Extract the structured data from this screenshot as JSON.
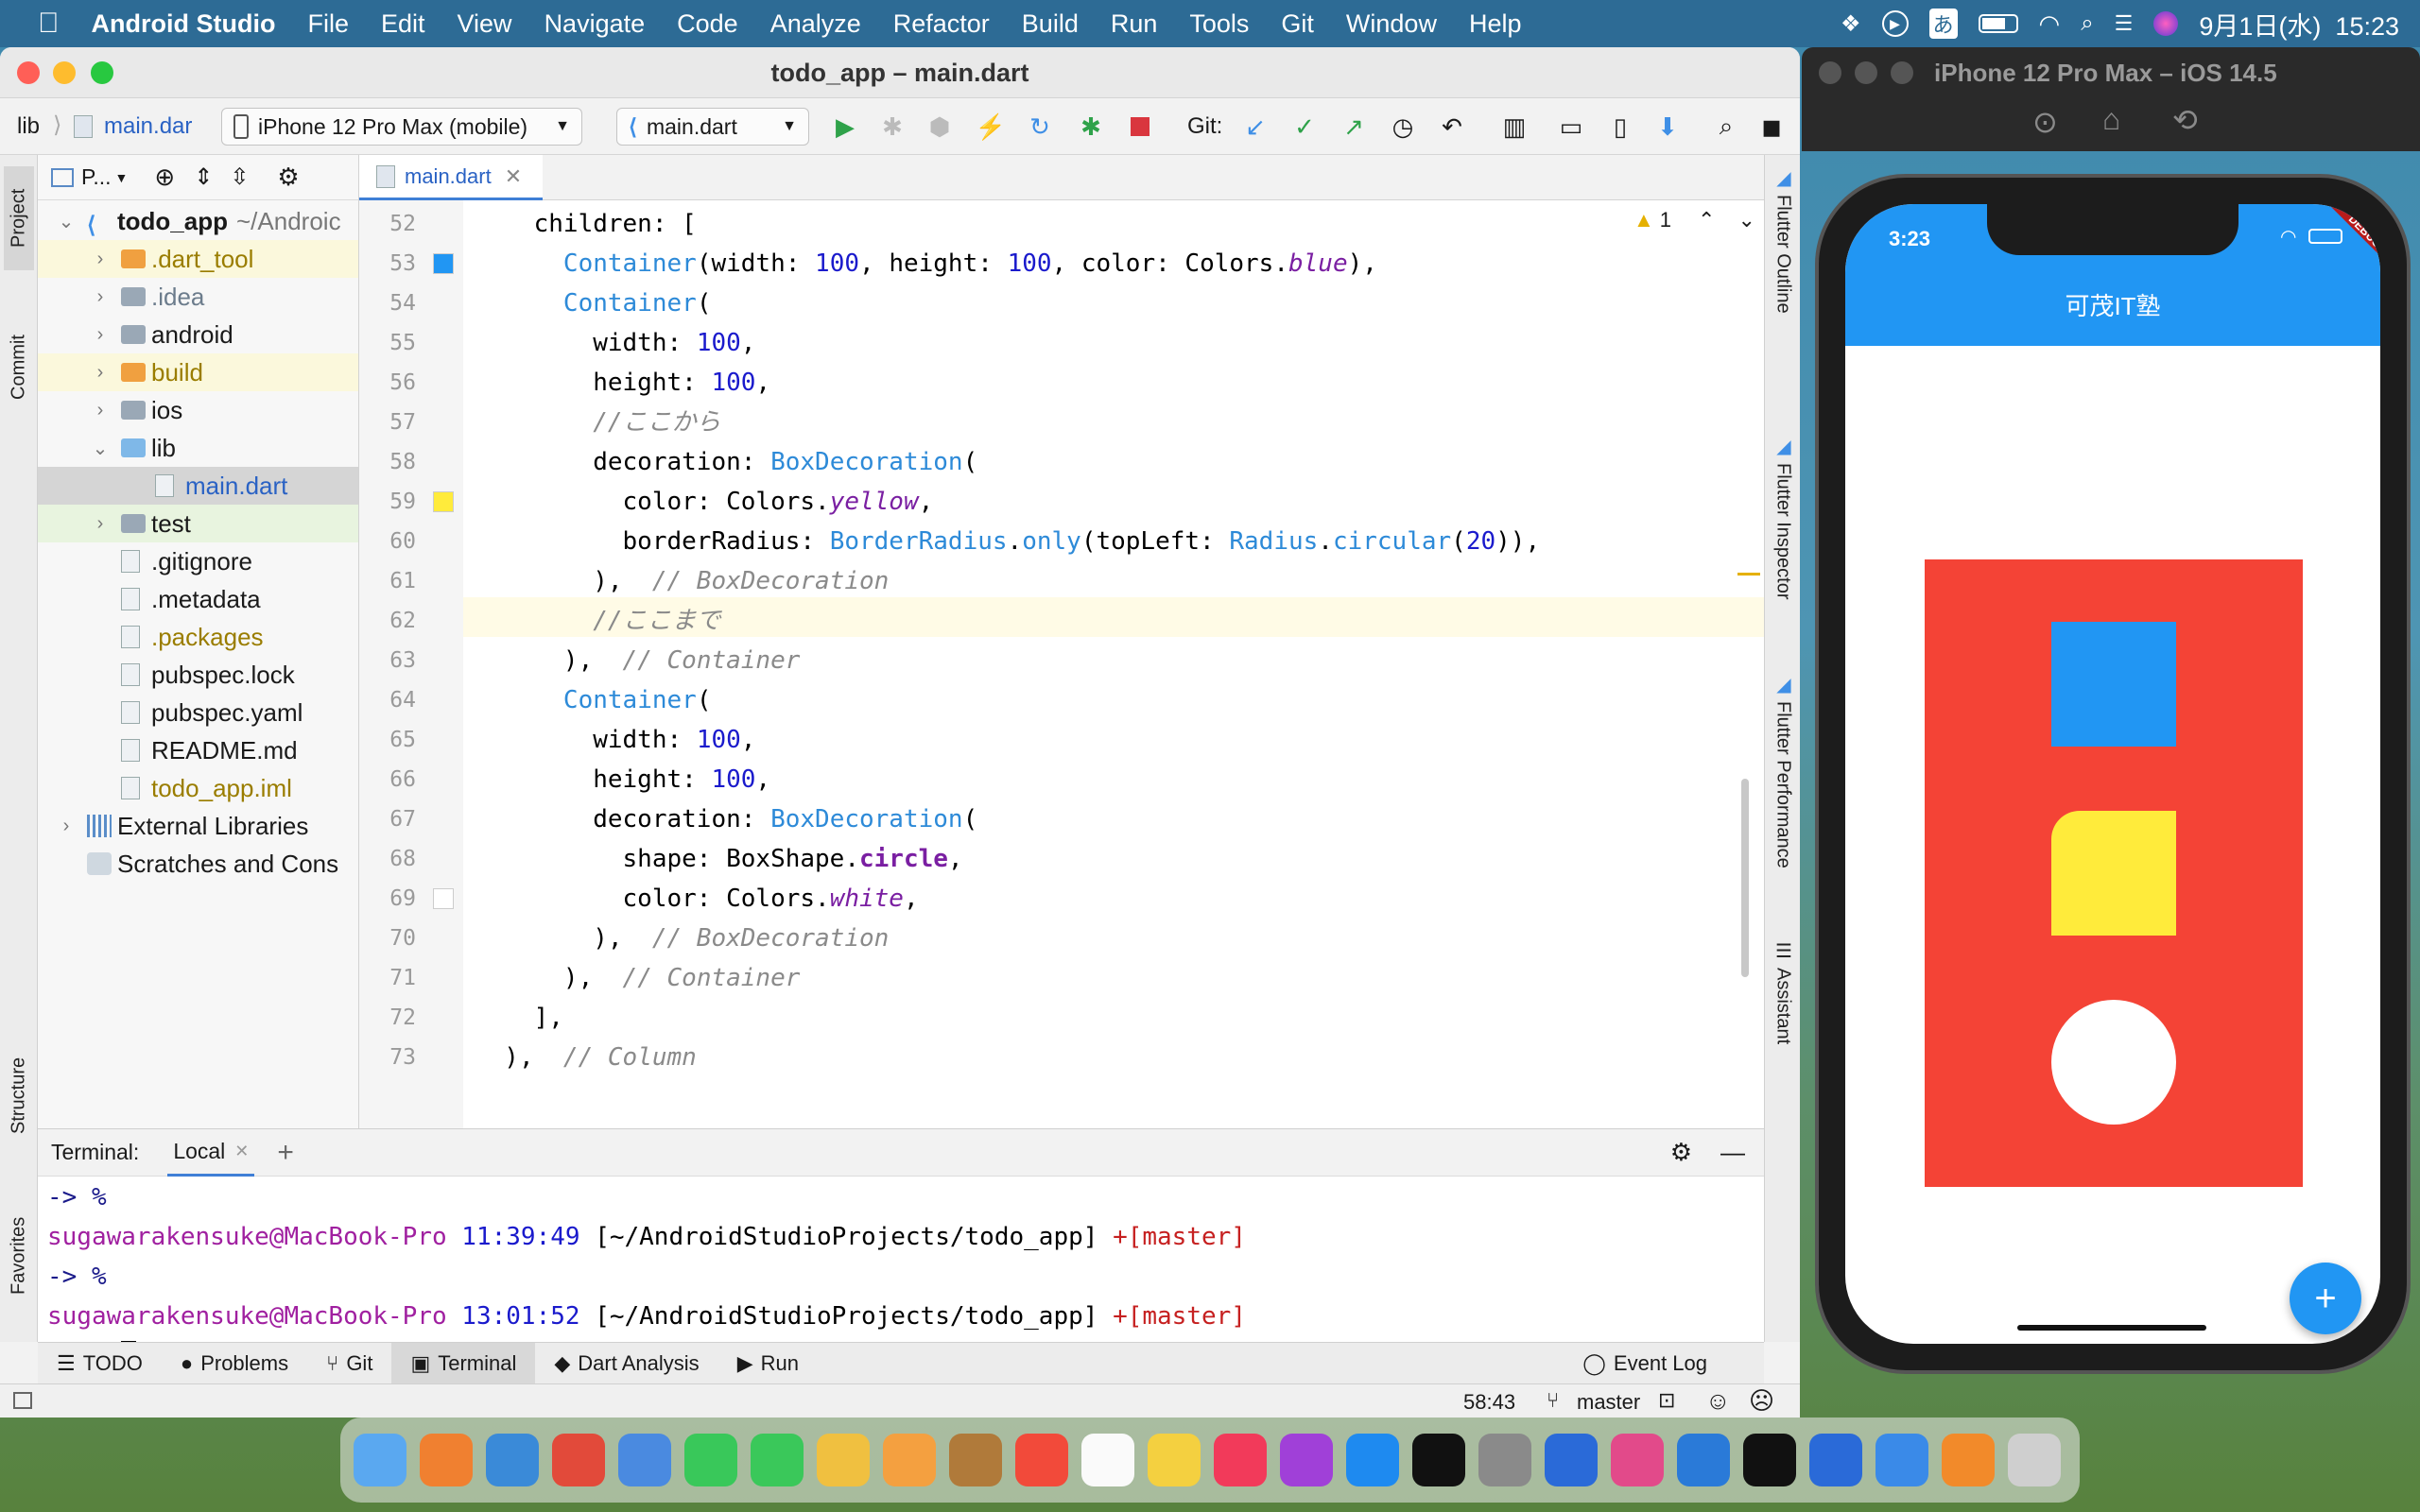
{
  "menubar": {
    "app_name": "Android Studio",
    "items": [
      "File",
      "Edit",
      "View",
      "Navigate",
      "Code",
      "Analyze",
      "Refactor",
      "Build",
      "Run",
      "Tools",
      "Git",
      "Window",
      "Help"
    ],
    "ime": "あ",
    "datetime": "9月1日(水)  15:23"
  },
  "ide": {
    "title": "todo_app – main.dart",
    "breadcrumb": [
      "lib",
      "main.dar"
    ],
    "device_selector": "iPhone 12 Pro Max (mobile)",
    "run_config": "main.dart",
    "git_label": "Git:",
    "project_header": "P...",
    "left_strip": [
      "Project",
      "Commit",
      "Structure",
      "Favorites"
    ],
    "right_strip": [
      "Flutter Outline",
      "Flutter Inspector",
      "Flutter Performance",
      "Assistant"
    ],
    "tree": [
      {
        "label": "todo_app",
        "suffix": "~/Androic",
        "depth": 0,
        "open": true,
        "bold": true
      },
      {
        "label": ".dart_tool",
        "depth": 1,
        "open": false,
        "color": "#9a7d00"
      },
      {
        "label": ".idea",
        "depth": 1,
        "open": false,
        "color": "#6c7c8c"
      },
      {
        "label": "android",
        "depth": 1,
        "open": false
      },
      {
        "label": "build",
        "depth": 1,
        "open": false,
        "color": "#9a7d00"
      },
      {
        "label": "ios",
        "depth": 1,
        "open": false
      },
      {
        "label": "lib",
        "depth": 1,
        "open": true
      },
      {
        "label": "main.dart",
        "depth": 2,
        "selected": true,
        "color": "#2a62c4"
      },
      {
        "label": "test",
        "depth": 1,
        "open": false
      },
      {
        "label": ".gitignore",
        "depth": 1
      },
      {
        "label": ".metadata",
        "depth": 1
      },
      {
        "label": ".packages",
        "depth": 1,
        "color": "#9a7d00"
      },
      {
        "label": "pubspec.lock",
        "depth": 1
      },
      {
        "label": "pubspec.yaml",
        "depth": 1
      },
      {
        "label": "README.md",
        "depth": 1
      },
      {
        "label": "todo_app.iml",
        "depth": 1,
        "color": "#9a7d00"
      },
      {
        "label": "External Libraries",
        "depth": 0,
        "open": false
      },
      {
        "label": "Scratches and Cons",
        "depth": 0
      }
    ],
    "tab": "main.dart",
    "warning_count": "1",
    "code_lines": [
      {
        "n": "52",
        "parts": [
          [
            "    children: [",
            ""
          ]
        ]
      },
      {
        "n": "53",
        "parts": [
          [
            "      ",
            ""
          ],
          [
            "Container",
            "cls"
          ],
          [
            "(width: ",
            ""
          ],
          [
            "100",
            "num"
          ],
          [
            ", height: ",
            ""
          ],
          [
            "100",
            "num"
          ],
          [
            ", color: Colors.",
            ""
          ],
          [
            "blue",
            "it"
          ],
          [
            "),",
            ""
          ]
        ]
      },
      {
        "n": "54",
        "parts": [
          [
            "      ",
            ""
          ],
          [
            "Container",
            "cls"
          ],
          [
            "(",
            ""
          ]
        ]
      },
      {
        "n": "55",
        "parts": [
          [
            "        width: ",
            ""
          ],
          [
            "100",
            "num"
          ],
          [
            ",",
            ""
          ]
        ]
      },
      {
        "n": "56",
        "parts": [
          [
            "        height: ",
            ""
          ],
          [
            "100",
            "num"
          ],
          [
            ",",
            ""
          ]
        ]
      },
      {
        "n": "57",
        "parts": [
          [
            "        //ここから",
            "cm"
          ]
        ]
      },
      {
        "n": "58",
        "parts": [
          [
            "        decoration: ",
            ""
          ],
          [
            "BoxDecoration",
            "cls"
          ],
          [
            "(",
            ""
          ]
        ]
      },
      {
        "n": "59",
        "parts": [
          [
            "          color: Colors.",
            ""
          ],
          [
            "yellow",
            "it"
          ],
          [
            ",",
            ""
          ]
        ]
      },
      {
        "n": "60",
        "parts": [
          [
            "          borderRadius: ",
            ""
          ],
          [
            "BorderRadius",
            "cls"
          ],
          [
            ".",
            ""
          ],
          [
            "only",
            "cls"
          ],
          [
            "(topLeft: ",
            ""
          ],
          [
            "Radius",
            "cls"
          ],
          [
            ".",
            ""
          ],
          [
            "circular",
            "cls"
          ],
          [
            "(",
            ""
          ],
          [
            "20",
            "num"
          ],
          [
            ")),",
            ""
          ]
        ]
      },
      {
        "n": "61",
        "parts": [
          [
            "        ),  ",
            ""
          ],
          [
            "// BoxDecoration",
            "cm"
          ]
        ]
      },
      {
        "n": "62",
        "parts": [
          [
            "        //ここまで",
            "cm"
          ]
        ]
      },
      {
        "n": "63",
        "parts": [
          [
            "      ),  ",
            ""
          ],
          [
            "// Container",
            "cm"
          ]
        ]
      },
      {
        "n": "64",
        "parts": [
          [
            "      ",
            ""
          ],
          [
            "Container",
            "cls"
          ],
          [
            "(",
            ""
          ]
        ]
      },
      {
        "n": "65",
        "parts": [
          [
            "        width: ",
            ""
          ],
          [
            "100",
            "num"
          ],
          [
            ",",
            ""
          ]
        ]
      },
      {
        "n": "66",
        "parts": [
          [
            "        height: ",
            ""
          ],
          [
            "100",
            "num"
          ],
          [
            ",",
            ""
          ]
        ]
      },
      {
        "n": "67",
        "parts": [
          [
            "        decoration: ",
            ""
          ],
          [
            "BoxDecoration",
            "cls"
          ],
          [
            "(",
            ""
          ]
        ]
      },
      {
        "n": "68",
        "parts": [
          [
            "          shape: BoxShape.",
            ""
          ],
          [
            "circle",
            "b"
          ],
          [
            ",",
            ""
          ]
        ]
      },
      {
        "n": "69",
        "parts": [
          [
            "          color: Colors.",
            ""
          ],
          [
            "white",
            "it"
          ],
          [
            ",",
            ""
          ]
        ]
      },
      {
        "n": "70",
        "parts": [
          [
            "        ),  ",
            ""
          ],
          [
            "// BoxDecoration",
            "cm"
          ]
        ]
      },
      {
        "n": "71",
        "parts": [
          [
            "      ),  ",
            ""
          ],
          [
            "// Container",
            "cm"
          ]
        ]
      },
      {
        "n": "72",
        "parts": [
          [
            "    ],",
            ""
          ]
        ]
      },
      {
        "n": "73",
        "parts": [
          [
            "  ),  ",
            ""
          ],
          [
            "// Column",
            "cm"
          ]
        ]
      }
    ],
    "terminal": {
      "label": "Terminal:",
      "tab": "Local",
      "lines": [
        {
          "prompt": "-> %"
        },
        {
          "user": "sugawarakensuke@MacBook-Pro",
          "time": "11:39:49",
          "path": "[~/AndroidStudioProjects/todo_app]",
          "branch": "+[master]"
        },
        {
          "prompt": "-> %"
        },
        {
          "user": "sugawarakensuke@MacBook-Pro",
          "time": "13:01:52",
          "path": "[~/AndroidStudioProjects/todo_app]",
          "branch": "+[master]"
        },
        {
          "prompt": "-> %",
          "cursor": true
        }
      ]
    },
    "tool_tabs": [
      "TODO",
      "Problems",
      "Git",
      "Terminal",
      "Dart Analysis",
      "Run"
    ],
    "event_log": "Event Log",
    "status": {
      "position": "58:43",
      "branch": "master"
    }
  },
  "simulator": {
    "title": "iPhone 12 Pro Max – iOS 14.5",
    "time": "3:23",
    "debug": "DEBUG",
    "app_title": "可茂IT塾",
    "fab": "+",
    "colors": {
      "appbar": "#2196f3",
      "background": "#f44336",
      "blue": "#2196f3",
      "yellow": "#ffeb3b",
      "white": "#ffffff"
    }
  }
}
